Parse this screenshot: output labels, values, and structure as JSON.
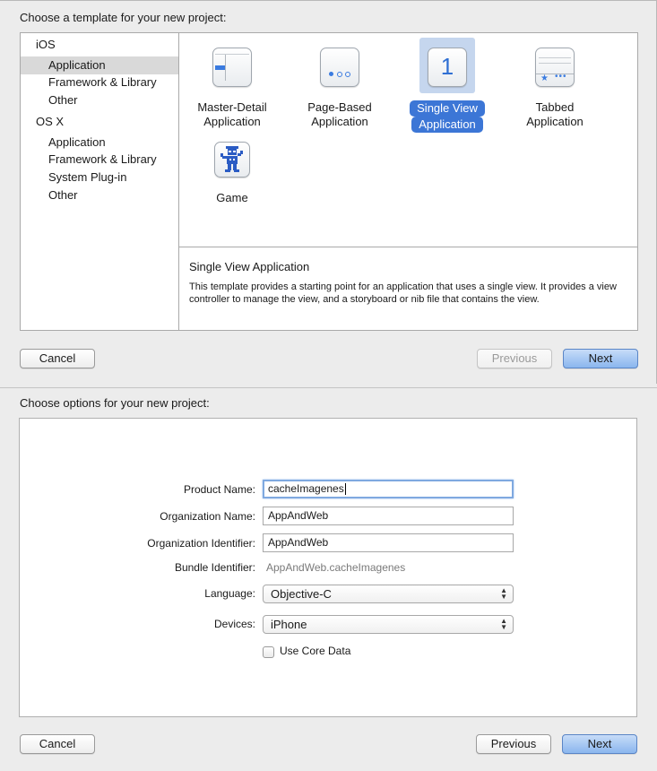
{
  "panel1": {
    "heading": "Choose a template for your new project:",
    "sidebar": {
      "groups": [
        {
          "label": "iOS",
          "items": [
            "Application",
            "Framework & Library",
            "Other"
          ]
        },
        {
          "label": "OS X",
          "items": [
            "Application",
            "Framework & Library",
            "System Plug-in",
            "Other"
          ]
        }
      ],
      "selected_item": "Application"
    },
    "templates": [
      {
        "line1": "Master-Detail",
        "line2": "Application",
        "icon": "master-detail-icon"
      },
      {
        "line1": "Page-Based",
        "line2": "Application",
        "icon": "page-based-icon"
      },
      {
        "line1": "Single View",
        "line2": "Application",
        "icon": "single-view-icon",
        "glyph": "1",
        "selected": true
      },
      {
        "line1": "Tabbed",
        "line2": "Application",
        "icon": "tabbed-icon"
      },
      {
        "line1": "Game",
        "line2": "",
        "icon": "game-icon"
      }
    ],
    "description": {
      "title": "Single View Application",
      "body": "This template provides a starting point for an application that uses a single view. It provides a view controller to manage the view, and a storyboard or nib file that contains the view."
    },
    "buttons": {
      "cancel": "Cancel",
      "previous": "Previous",
      "next": "Next"
    },
    "colors": {
      "selection": "#3c76d6",
      "primary_button": "#8ab6ee"
    }
  },
  "panel2": {
    "heading": "Choose options for your new project:",
    "fields": {
      "product_name": {
        "label": "Product Name:",
        "value": "cacheImagenes"
      },
      "organization_name": {
        "label": "Organization Name:",
        "value": "AppAndWeb"
      },
      "organization_identifier": {
        "label": "Organization Identifier:",
        "value": "AppAndWeb"
      },
      "bundle_identifier": {
        "label": "Bundle Identifier:",
        "value": "AppAndWeb.cacheImagenes"
      },
      "language": {
        "label": "Language:",
        "value": "Objective-C"
      },
      "devices": {
        "label": "Devices:",
        "value": "iPhone"
      },
      "core_data": {
        "label": "Use Core Data",
        "checked": false
      }
    },
    "buttons": {
      "cancel": "Cancel",
      "previous": "Previous",
      "next": "Next"
    }
  }
}
